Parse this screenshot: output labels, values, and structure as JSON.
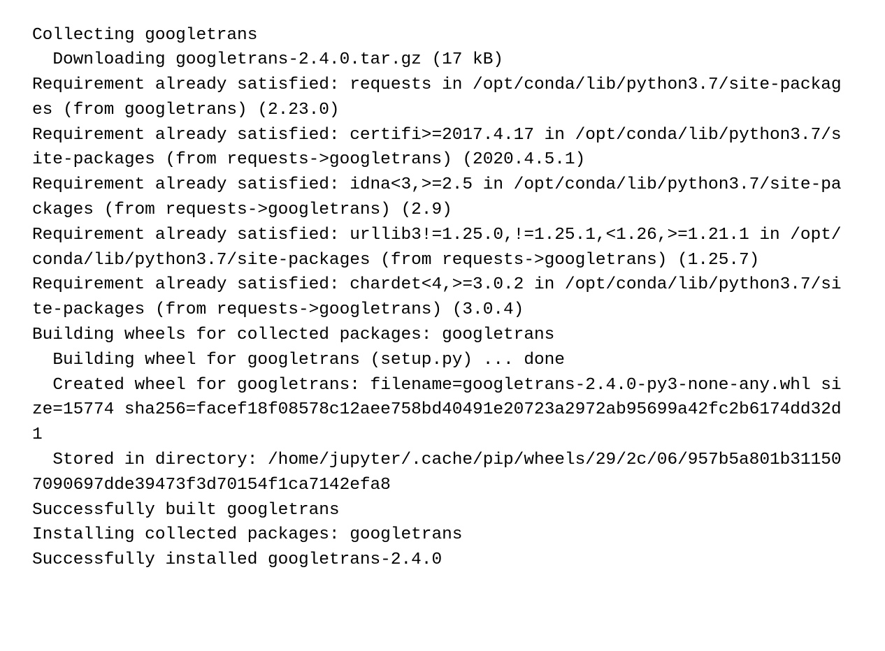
{
  "terminal": {
    "background_color": "#ffffff",
    "text_color": "#000000",
    "wrap_columns": 81,
    "package": "googletrans",
    "version": "2.4.0",
    "lines": [
      "Collecting googletrans",
      "  Downloading googletrans-2.4.0.tar.gz (17 kB)",
      "Requirement already satisfied: requests in /opt/conda/lib/python3.7/site-packages (from googletrans) (2.23.0)",
      "Requirement already satisfied: certifi>=2017.4.17 in /opt/conda/lib/python3.7/site-packages (from requests->googletrans) (2020.4.5.1)",
      "Requirement already satisfied: idna<3,>=2.5 in /opt/conda/lib/python3.7/site-packages (from requests->googletrans) (2.9)",
      "Requirement already satisfied: urllib3!=1.25.0,!=1.25.1,<1.26,>=1.21.1 in /opt/conda/lib/python3.7/site-packages (from requests->googletrans) (1.25.7)",
      "Requirement already satisfied: chardet<4,>=3.0.2 in /opt/conda/lib/python3.7/site-packages (from requests->googletrans) (3.0.4)",
      "Building wheels for collected packages: googletrans",
      "  Building wheel for googletrans (setup.py) ... done",
      "  Created wheel for googletrans: filename=googletrans-2.4.0-py3-none-any.whl size=15774 sha256=facef18f08578c12aee758bd40491e20723a2972ab95699a42fc2b6174dd32d1",
      "  Stored in directory: /home/jupyter/.cache/pip/wheels/29/2c/06/957b5a801b311507090697dde39473f3d70154f1ca7142efa8",
      "Successfully built googletrans",
      "Installing collected packages: googletrans",
      "Successfully installed googletrans-2.4.0"
    ]
  }
}
